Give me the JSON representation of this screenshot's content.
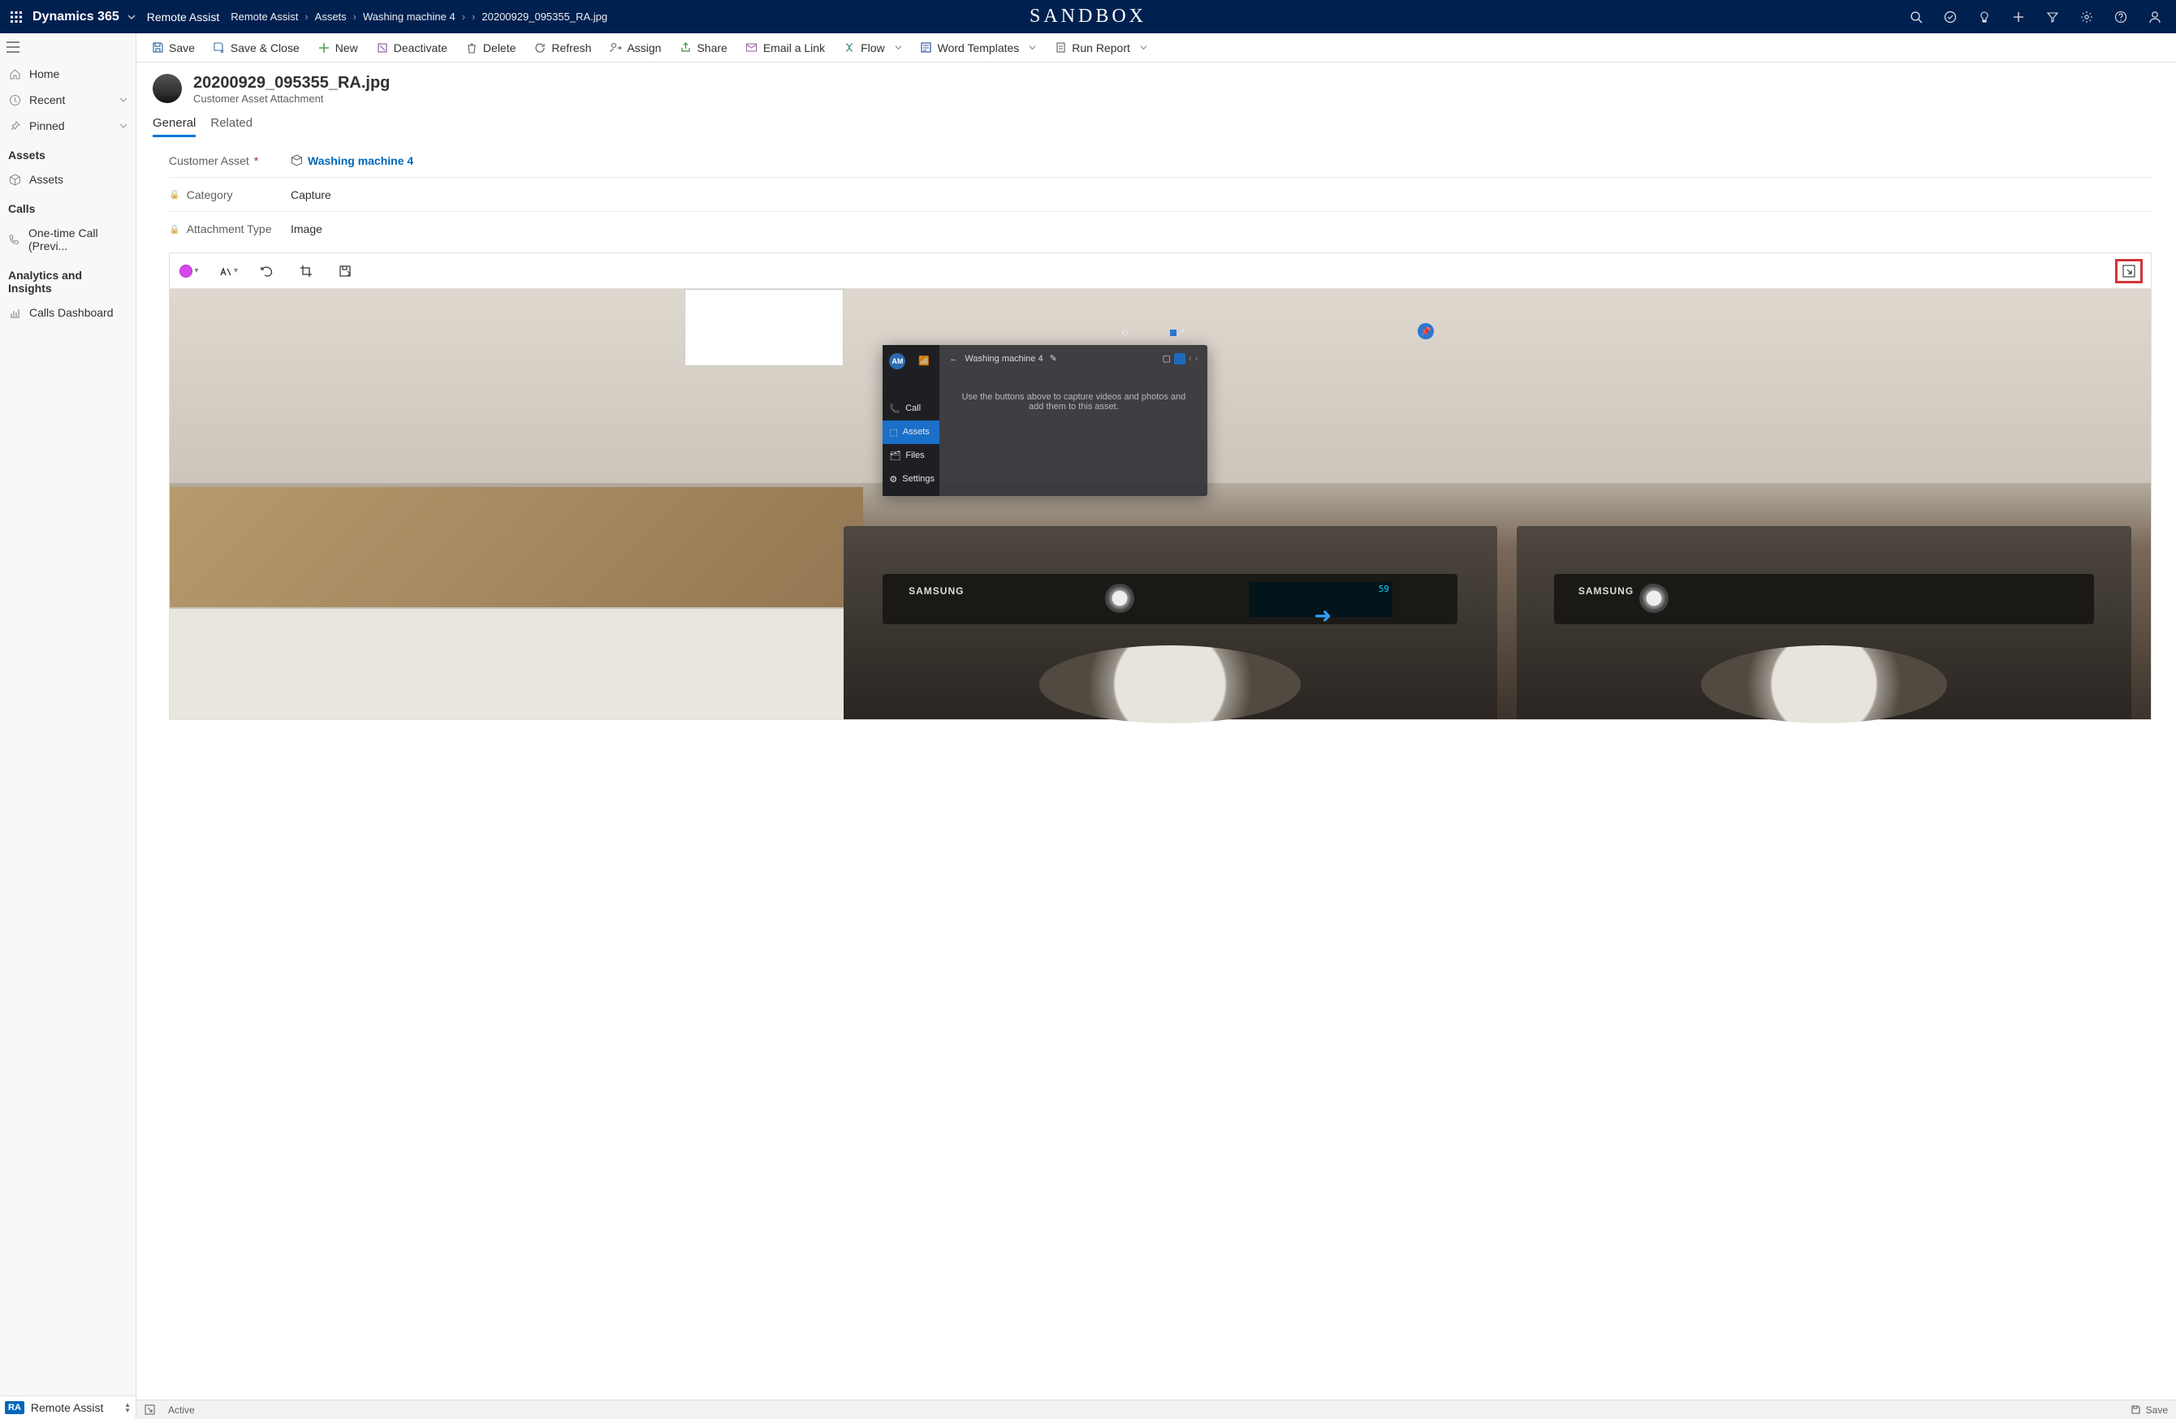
{
  "topbar": {
    "brand": "Dynamics 365",
    "app_name": "Remote Assist",
    "sandbox_label": "SANDBOX"
  },
  "breadcrumbs": [
    "Remote Assist",
    "Assets",
    "Washing machine 4",
    "20200929_095355_RA.jpg"
  ],
  "commands": {
    "save": "Save",
    "save_close": "Save & Close",
    "new": "New",
    "deactivate": "Deactivate",
    "delete": "Delete",
    "refresh": "Refresh",
    "assign": "Assign",
    "share": "Share",
    "email_link": "Email a Link",
    "flow": "Flow",
    "word_templates": "Word Templates",
    "run_report": "Run Report"
  },
  "nav": {
    "home": "Home",
    "recent": "Recent",
    "pinned": "Pinned",
    "section_assets": "Assets",
    "assets": "Assets",
    "section_calls": "Calls",
    "one_time_call": "One-time Call (Previ...",
    "section_analytics": "Analytics and Insights",
    "calls_dashboard": "Calls Dashboard",
    "bottom_chip": "RA",
    "bottom_label": "Remote Assist"
  },
  "record": {
    "title": "20200929_095355_RA.jpg",
    "subtitle": "Customer Asset Attachment"
  },
  "tabs": {
    "general": "General",
    "related": "Related"
  },
  "fields": {
    "customer_asset_label": "Customer Asset",
    "customer_asset_value": "Washing machine 4",
    "category_label": "Category",
    "category_value": "Capture",
    "attachment_type_label": "Attachment Type",
    "attachment_type_value": "Image"
  },
  "ar_panel": {
    "avatar": "AM",
    "title": "Washing machine 4",
    "call": "Call",
    "assets": "Assets",
    "files": "Files",
    "settings": "Settings",
    "hint": "Use the buttons above to capture videos and photos and add them to this asset."
  },
  "washer": {
    "brand_a": "SAMSUNG",
    "brand_b": "SAMSUNG"
  },
  "footer": {
    "status": "Active",
    "save": "Save"
  }
}
